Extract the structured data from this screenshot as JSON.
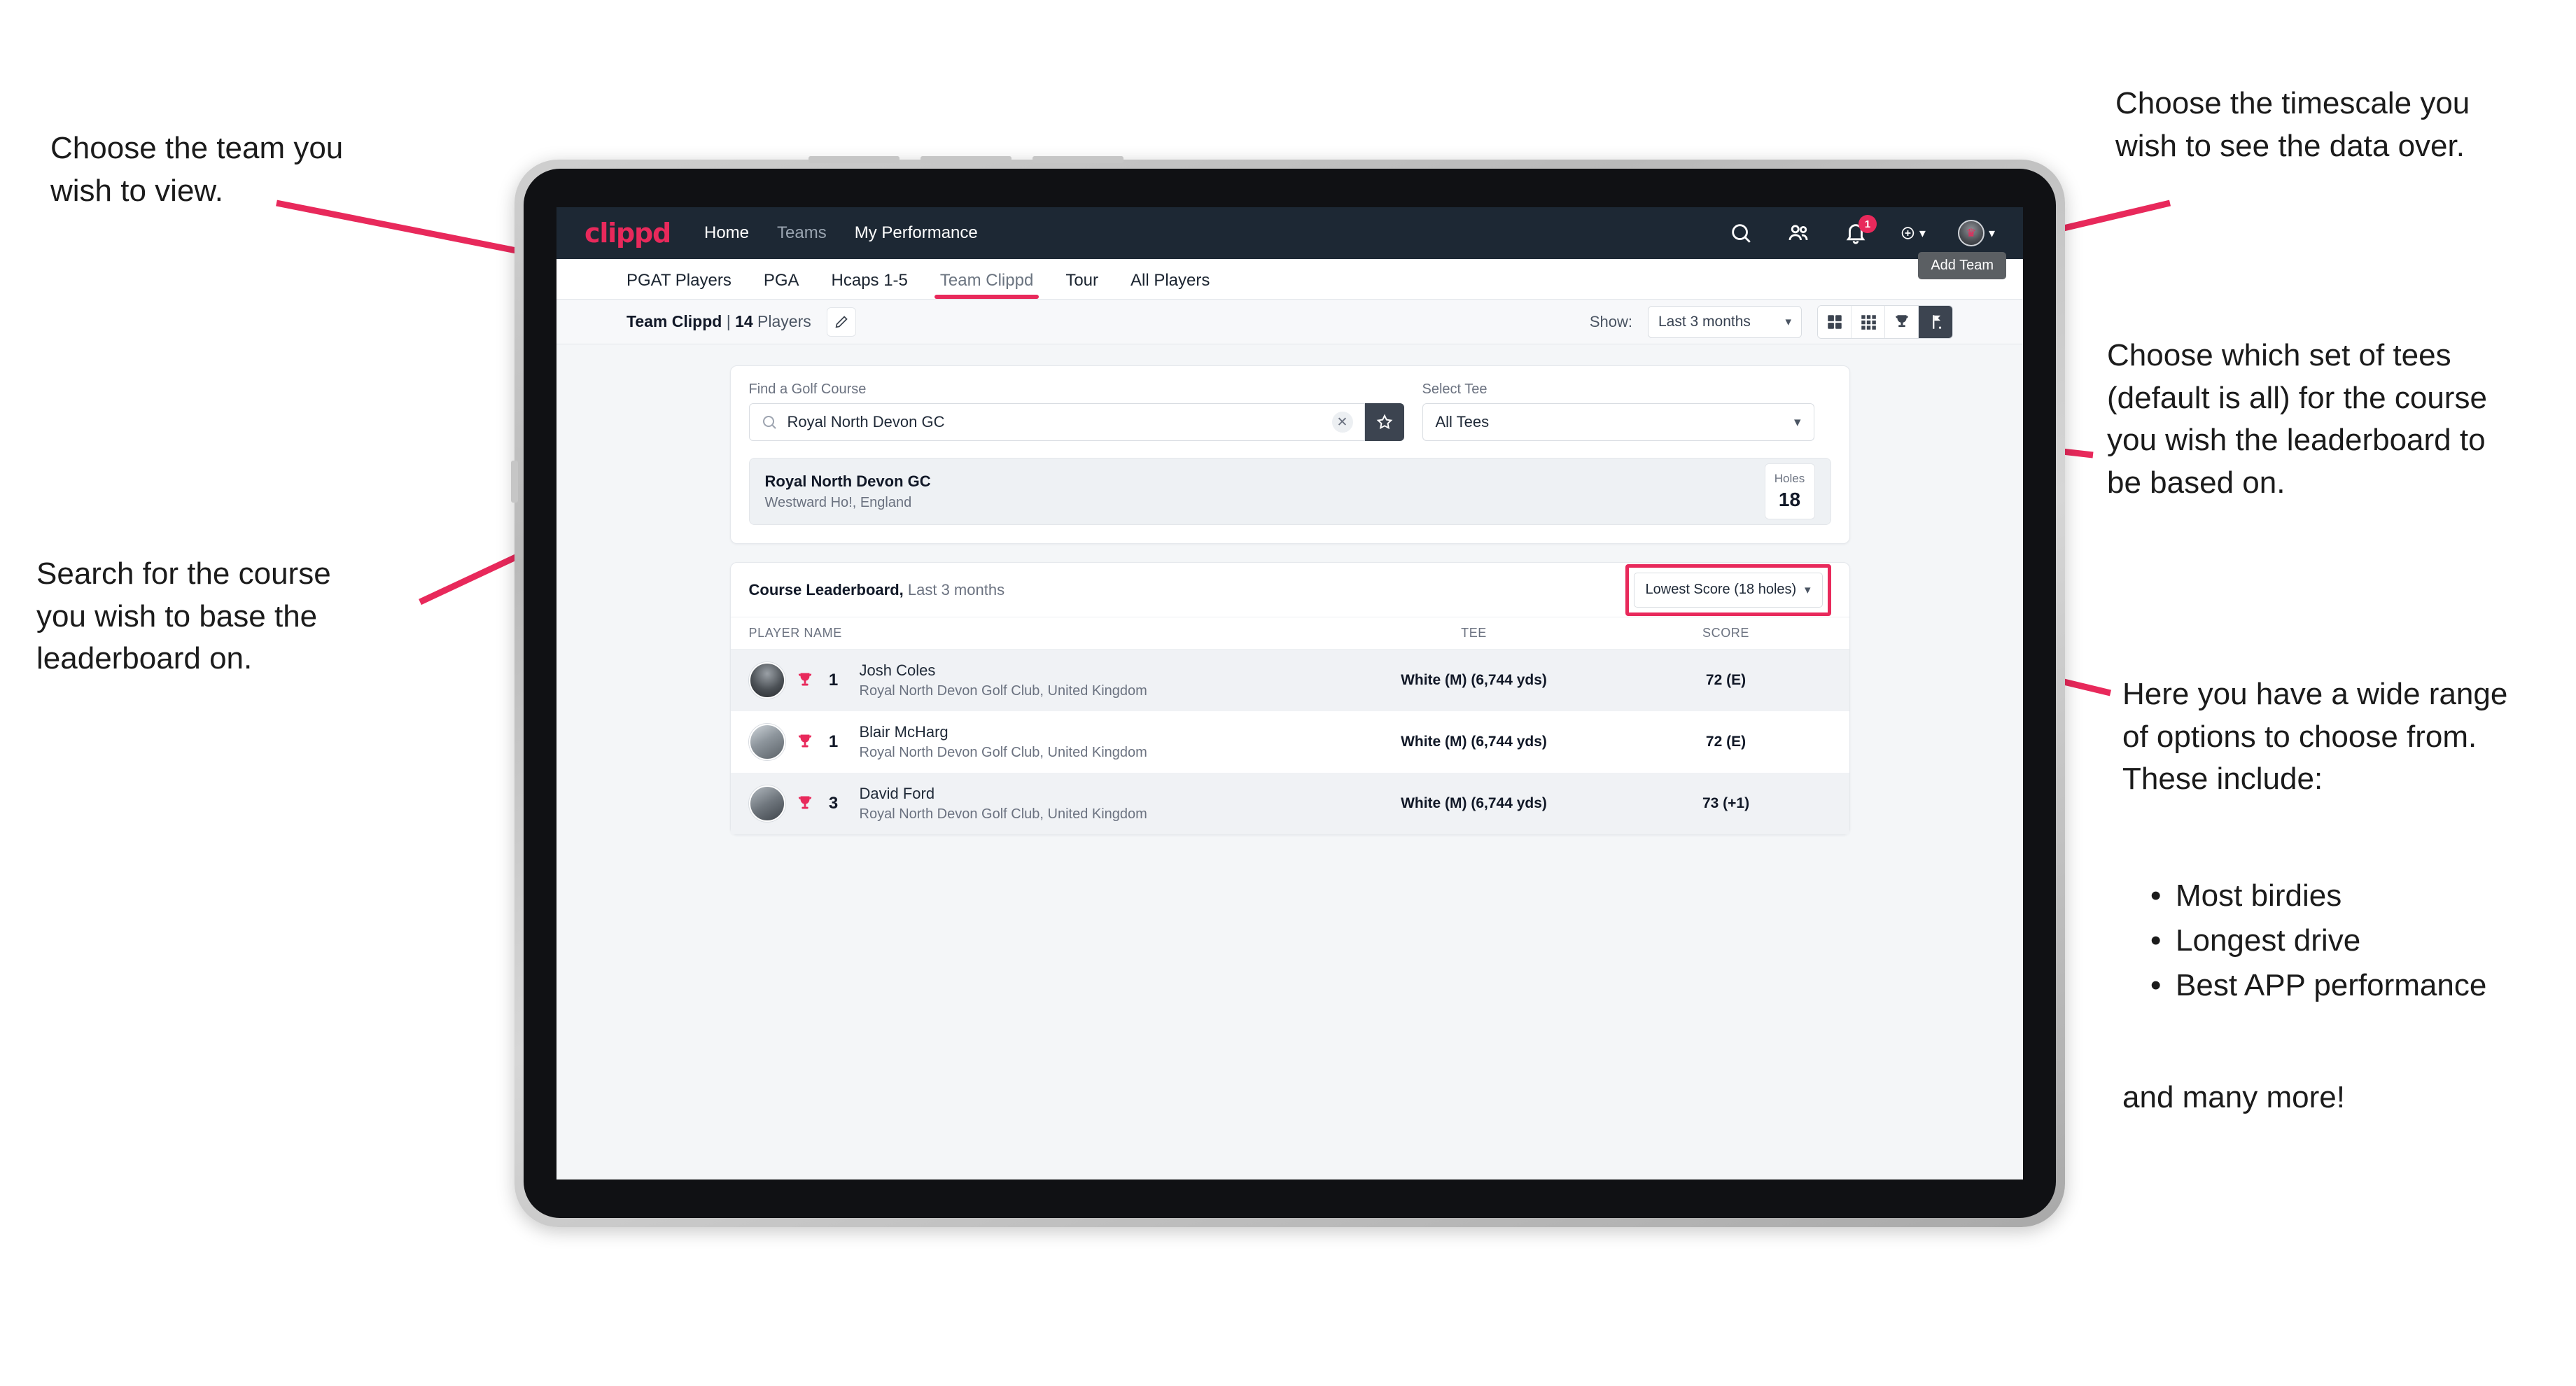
{
  "annotations": {
    "team": "Choose the team you\nwish to view.",
    "search": "Search for the course\nyou wish to base the\nleaderboard on.",
    "timescale": "Choose the timescale you\nwish to see the data over.",
    "tees": "Choose which set of tees\n(default is all) for the course\nyou wish the leaderboard to\nbe based on.",
    "options_intro": "Here you have a wide range\nof options to choose from.\nThese include:",
    "options_list": [
      "Most birdies",
      "Longest drive",
      "Best APP performance"
    ],
    "options_outro": "and many more!"
  },
  "app": {
    "brand": "clippd",
    "nav_links": [
      {
        "label": "Home",
        "active": true
      },
      {
        "label": "Teams",
        "active": false
      },
      {
        "label": "My Performance",
        "active": true
      }
    ],
    "nav_icons": [
      "search-icon",
      "people-icon",
      "bell-icon",
      "plus-circle-icon",
      "avatar-icon"
    ],
    "notification_count": "1",
    "tooltip": "Add Team"
  },
  "tabs": [
    {
      "label": "PGAT Players",
      "active": false
    },
    {
      "label": "PGA",
      "active": false
    },
    {
      "label": "Hcaps 1-5",
      "active": false
    },
    {
      "label": "Team Clippd",
      "active": true
    },
    {
      "label": "Tour",
      "active": false
    },
    {
      "label": "All Players",
      "active": false
    }
  ],
  "teambar": {
    "team_name": "Team Clippd",
    "separator": " | ",
    "player_count": "14",
    "players_word": " Players",
    "edit_icon": "pencil-icon",
    "show_label": "Show:",
    "show_value": "Last 3 months",
    "view_modes": [
      "grid-large-icon",
      "grid-small-icon",
      "trophy-icon",
      "golf-flag-icon"
    ],
    "active_view": "golf-flag-icon"
  },
  "search": {
    "course_label": "Find a Golf Course",
    "course_value": "Royal North Devon GC",
    "course_placeholder": "Find a Golf Course",
    "clear_label": "✕",
    "star_icon": "star-icon",
    "tee_label": "Select Tee",
    "tee_value": "All Tees"
  },
  "course_result": {
    "name": "Royal North Devon GC",
    "location": "Westward Ho!, England",
    "holes_label": "Holes",
    "holes_value": "18"
  },
  "leaderboard": {
    "title": "Course Leaderboard,",
    "subtitle": " Last 3 months",
    "sort_value": "Lowest Score (18 holes)",
    "columns": [
      "PLAYER NAME",
      "TEE",
      "SCORE"
    ],
    "rows": [
      {
        "rank": "1",
        "name": "Josh Coles",
        "club": "Royal North Devon Golf Club, United Kingdom",
        "tee": "White (M) (6,744 yds)",
        "score": "72 (E)"
      },
      {
        "rank": "1",
        "name": "Blair McHarg",
        "club": "Royal North Devon Golf Club, United Kingdom",
        "tee": "White (M) (6,744 yds)",
        "score": "72 (E)"
      },
      {
        "rank": "3",
        "name": "David Ford",
        "club": "Royal North Devon Golf Club, United Kingdom",
        "tee": "White (M) (6,744 yds)",
        "score": "73 (+1)"
      }
    ]
  },
  "colors": {
    "accent": "#e8295b",
    "navbar": "#1d2834",
    "dark_button": "#3c4450"
  }
}
